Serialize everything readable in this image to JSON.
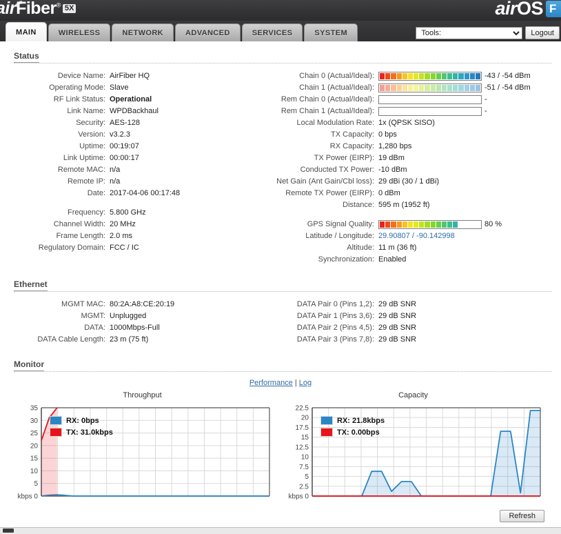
{
  "header": {
    "brand_air": "air",
    "brand_fiber": "Fiber",
    "brand_reg": "®",
    "brand_model": "5X",
    "os_air": "air",
    "os_name": "OS",
    "os_badge": "F",
    "wave_icon": "signal-wave-icon"
  },
  "tabs": [
    {
      "label": "MAIN",
      "active": true
    },
    {
      "label": "WIRELESS",
      "active": false
    },
    {
      "label": "NETWORK",
      "active": false
    },
    {
      "label": "ADVANCED",
      "active": false
    },
    {
      "label": "SERVICES",
      "active": false
    },
    {
      "label": "SYSTEM",
      "active": false
    }
  ],
  "toolbar": {
    "tools_label": "Tools:",
    "tools_options": [
      "Tools:"
    ],
    "logout_label": "Logout"
  },
  "status": {
    "title": "Status",
    "left": [
      {
        "label": "Device Name:",
        "value": "AirFiber HQ"
      },
      {
        "label": "Operating Mode:",
        "value": "Slave"
      },
      {
        "label": "RF Link Status:",
        "value": "Operational",
        "bold": true
      },
      {
        "label": "Link Name:",
        "value": "WPDBackhaul"
      },
      {
        "label": "Security:",
        "value": "AES-128"
      },
      {
        "label": "Version:",
        "value": "v3.2.3"
      },
      {
        "label": "Uptime:",
        "value": "00:19:07"
      },
      {
        "label": "Link Uptime:",
        "value": "00:00:17"
      },
      {
        "label": "Remote MAC:",
        "value": "n/a"
      },
      {
        "label": "Remote IP:",
        "value": "n/a"
      },
      {
        "label": "Date:",
        "value": "2017-04-06 00:17:48"
      },
      {
        "label": "Frequency:",
        "value": "5.800 GHz",
        "gap_before": true
      },
      {
        "label": "Channel Width:",
        "value": "20 MHz"
      },
      {
        "label": "Frame Length:",
        "value": "2.0 ms"
      },
      {
        "label": "Regulatory Domain:",
        "value": "FCC / IC"
      }
    ],
    "chains": [
      {
        "label": "Chain 0 (Actual/Ideal):",
        "value": "-43 / -54 dBm",
        "fill_pct": 100,
        "faded": false
      },
      {
        "label": "Chain 1 (Actual/Ideal):",
        "value": "-51 / -54 dBm",
        "fill_pct": 100,
        "faded": true
      },
      {
        "label": "Rem Chain 0 (Actual/Ideal):",
        "value": "-",
        "fill_pct": 0,
        "faded": false
      },
      {
        "label": "Rem Chain 1 (Actual/Ideal):",
        "value": "-",
        "fill_pct": 0,
        "faded": false
      }
    ],
    "right": [
      {
        "label": "Local Modulation Rate:",
        "value": "1x (QPSK SISO)"
      },
      {
        "label": "TX Capacity:",
        "value": "0 bps"
      },
      {
        "label": "RX Capacity:",
        "value": "1,280 bps"
      },
      {
        "label": "TX Power (EIRP):",
        "value": "19 dBm"
      },
      {
        "label": "Conducted TX Power:",
        "value": "-10 dBm"
      },
      {
        "label": "Net Gain (Ant Gain/Cbl loss):",
        "value": "29 dBi (30 / 1 dBi)"
      },
      {
        "label": "Remote TX Power (EIRP):",
        "value": "0 dBm"
      },
      {
        "label": "Distance:",
        "value": "595 m (1952 ft)"
      }
    ],
    "gps": {
      "label": "GPS Signal Quality:",
      "value": "80 %",
      "fill_pct": 80
    },
    "gps_rows": [
      {
        "label": "Latitude / Longitude:",
        "value": "29.90807 / -90.142998",
        "link": true
      },
      {
        "label": "Altitude:",
        "value": "11 m (36 ft)"
      },
      {
        "label": "Synchronization:",
        "value": "Enabled"
      }
    ]
  },
  "ethernet": {
    "title": "Ethernet",
    "left": [
      {
        "label": "MGMT MAC:",
        "value": "80:2A:A8:CE:20:19"
      },
      {
        "label": "MGMT:",
        "value": "Unplugged"
      },
      {
        "label": "DATA:",
        "value": "1000Mbps-Full"
      },
      {
        "label": "DATA Cable Length:",
        "value": "23 m (75 ft)"
      }
    ],
    "right": [
      {
        "label": "DATA Pair 0 (Pins 1,2):",
        "value": "29 dB SNR"
      },
      {
        "label": "DATA Pair 1 (Pins 3,6):",
        "value": "29 dB SNR"
      },
      {
        "label": "DATA Pair 2 (Pins 4,5):",
        "value": "29 dB SNR"
      },
      {
        "label": "DATA Pair 3 (Pins 7,8):",
        "value": "29 dB SNR"
      }
    ]
  },
  "monitor": {
    "title": "Monitor",
    "performance_link": "Performance",
    "separator": "|",
    "log_link": "Log"
  },
  "refresh": {
    "label": "Refresh"
  },
  "colors": {
    "rx_blue": "#2b86c5",
    "tx_red": "#e8141b",
    "link_blue": "#2e6da4",
    "grid": "#d9d9d9",
    "axis": "#555555"
  },
  "chart_data": [
    {
      "type": "line",
      "title": "Throughput",
      "xlabel": "",
      "ylabel": "kbps",
      "ylim": [
        0,
        35
      ],
      "yticks": [
        0,
        5,
        10,
        15,
        20,
        25,
        30,
        35
      ],
      "grid": true,
      "legend_position": "top-left",
      "series": [
        {
          "name": "RX: 0bps",
          "color": "#2b86c5",
          "values": [
            0.0,
            0.35,
            0.5,
            0.3,
            0.0,
            0,
            0,
            0,
            0,
            0,
            0,
            0,
            0,
            0,
            0,
            0,
            0,
            0,
            0,
            0,
            0,
            0,
            0,
            0,
            0,
            0,
            0,
            0,
            0,
            0
          ]
        },
        {
          "name": "TX: 31.0kbps",
          "color": "#e8141b",
          "values": [
            22.0,
            31.0,
            38.0,
            null,
            null,
            null,
            null,
            null,
            null,
            null,
            null,
            null,
            null,
            null,
            null,
            null,
            null,
            null,
            null,
            null,
            null,
            null,
            null,
            null,
            null,
            null,
            null,
            null,
            null,
            null
          ]
        }
      ]
    },
    {
      "type": "line",
      "title": "Capacity",
      "xlabel": "",
      "ylabel": "kbps",
      "ylim": [
        0,
        22.5
      ],
      "yticks": [
        0,
        2.5,
        5,
        7.5,
        10,
        12.5,
        15,
        17.5,
        20,
        22.5
      ],
      "grid": true,
      "legend_position": "top-left",
      "series": [
        {
          "name": "RX: 21.8kbps",
          "color": "#2b86c5",
          "values": [
            0,
            0,
            0,
            0,
            0,
            0,
            6.3,
            6.3,
            1.2,
            3.7,
            3.7,
            0,
            0,
            0,
            0,
            0,
            0,
            0,
            0,
            16.5,
            16.5,
            0.8,
            21.8,
            21.8
          ]
        },
        {
          "name": "TX: 0.00bps",
          "color": "#e8141b",
          "values": [
            0,
            0,
            0,
            0,
            0,
            0,
            0,
            0,
            0,
            0,
            0,
            0,
            0,
            0,
            0,
            0,
            0,
            0,
            0,
            0,
            0,
            0,
            0,
            0
          ]
        }
      ]
    }
  ]
}
